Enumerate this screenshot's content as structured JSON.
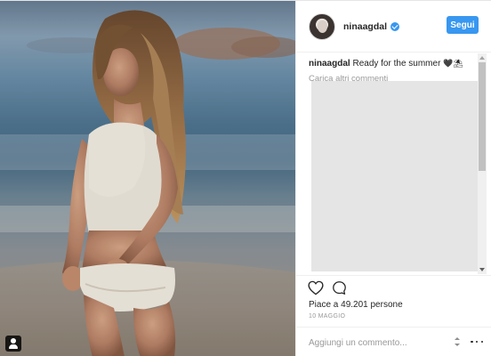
{
  "post": {
    "username": "ninaagdal",
    "verified": true,
    "follow_label": "Segui",
    "caption_user": "ninaagdal",
    "caption_text": "Ready for the summer",
    "caption_emoji": "🖤⛱",
    "load_more_label": "Carica altri commenti",
    "likes_text": "Piace a 49.201 persone",
    "date": "10 MAGGIO",
    "add_comment_placeholder": "Aggiungi un commento..."
  },
  "icons": {
    "like": "heart-icon",
    "comment": "comment-bubble-icon",
    "user_tag": "user-tag-icon",
    "verified": "verified-badge-icon",
    "more": "more-options-icon"
  },
  "colors": {
    "accent": "#3897f0",
    "text": "#262626",
    "muted": "#999999",
    "border": "#efefef"
  }
}
